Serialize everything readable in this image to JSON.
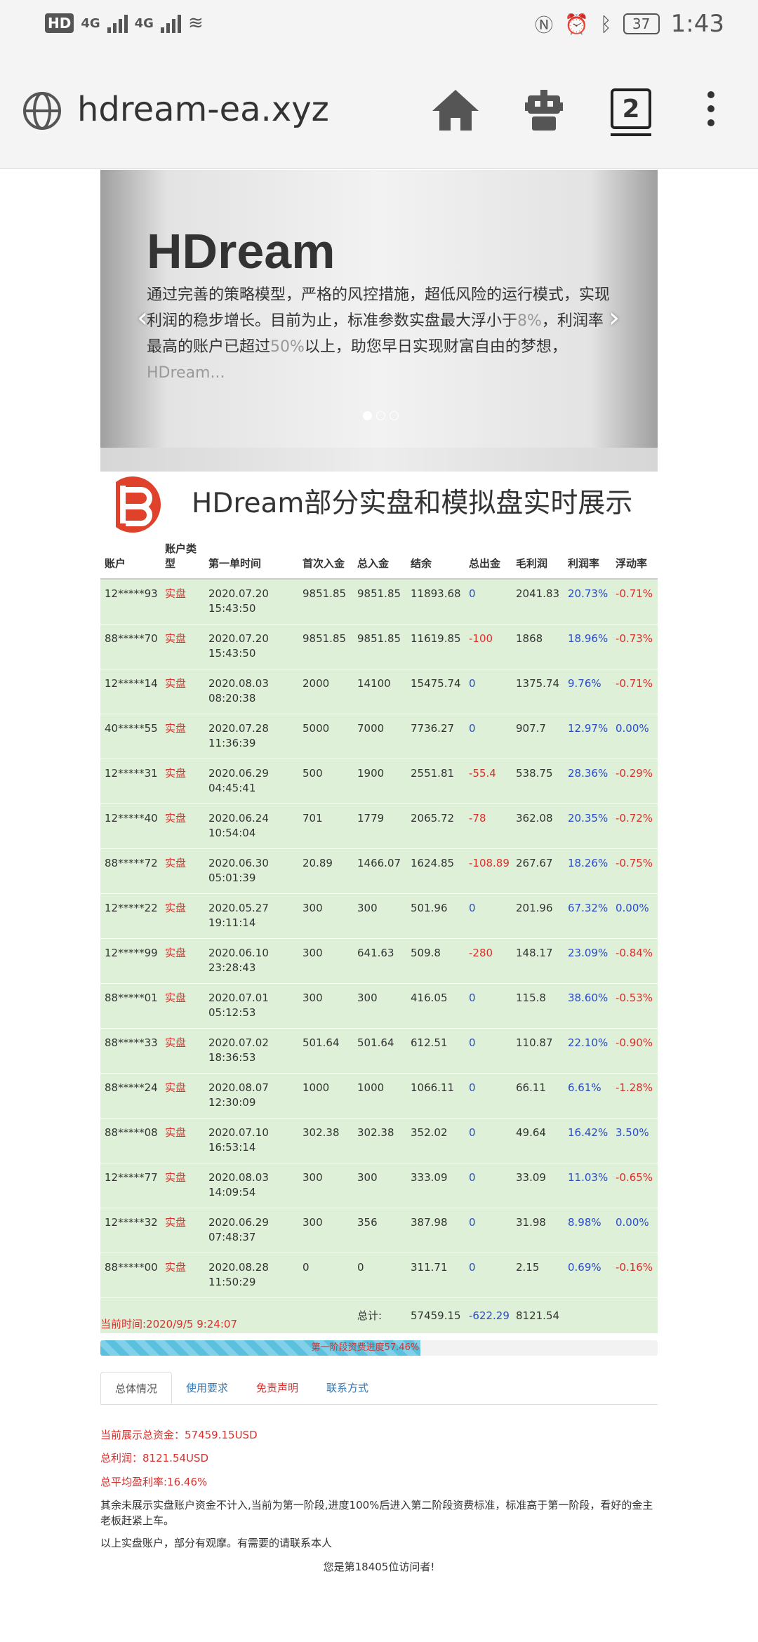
{
  "status_bar": {
    "hd_label": "HD",
    "net_a": "4G",
    "net_b": "4G",
    "battery": "37",
    "time": "1:43"
  },
  "browser": {
    "url": "hdream-ea.xyz",
    "tab_count": "2"
  },
  "carousel": {
    "title": "HDream",
    "text_1": "通过完善的策略模型，严格的风控措施，超低风险的运行模式，实现利润的稳步增长。目前为止，标准参数实盘最大浮小于",
    "text_2": "8%",
    "text_3": "，利润率最高的账户已超过",
    "text_4": "50%",
    "text_5": "以上，助您早日实现财富自由的梦想，",
    "text_6": "HDream...",
    "slide_count": 3,
    "active_slide": 1
  },
  "table": {
    "title": "HDream部分实盘和模拟盘实时展示",
    "headers": [
      "账户",
      "账户类型",
      "第一单时间",
      "首次入金",
      "总入金",
      "结余",
      "总出金",
      "毛利润",
      "利润率",
      "浮动率"
    ],
    "rows": [
      [
        "12*****93",
        "实盘",
        "2020.07.20 15:43:50",
        "9851.85",
        "9851.85",
        "11893.68",
        "0",
        "2041.83",
        "20.73%",
        "-0.71%"
      ],
      [
        "88*****70",
        "实盘",
        "2020.07.20 15:43:50",
        "9851.85",
        "9851.85",
        "11619.85",
        "-100",
        "1868",
        "18.96%",
        "-0.73%"
      ],
      [
        "12*****14",
        "实盘",
        "2020.08.03 08:20:38",
        "2000",
        "14100",
        "15475.74",
        "0",
        "1375.74",
        "9.76%",
        "-0.71%"
      ],
      [
        "40*****55",
        "实盘",
        "2020.07.28 11:36:39",
        "5000",
        "7000",
        "7736.27",
        "0",
        "907.7",
        "12.97%",
        "0.00%"
      ],
      [
        "12*****31",
        "实盘",
        "2020.06.29 04:45:41",
        "500",
        "1900",
        "2551.81",
        "-55.4",
        "538.75",
        "28.36%",
        "-0.29%"
      ],
      [
        "12*****40",
        "实盘",
        "2020.06.24 10:54:04",
        "701",
        "1779",
        "2065.72",
        "-78",
        "362.08",
        "20.35%",
        "-0.72%"
      ],
      [
        "88*****72",
        "实盘",
        "2020.06.30 05:01:39",
        "20.89",
        "1466.07",
        "1624.85",
        "-108.89",
        "267.67",
        "18.26%",
        "-0.75%"
      ],
      [
        "12*****22",
        "实盘",
        "2020.05.27 19:11:14",
        "300",
        "300",
        "501.96",
        "0",
        "201.96",
        "67.32%",
        "0.00%"
      ],
      [
        "12*****99",
        "实盘",
        "2020.06.10 23:28:43",
        "300",
        "641.63",
        "509.8",
        "-280",
        "148.17",
        "23.09%",
        "-0.84%"
      ],
      [
        "88*****01",
        "实盘",
        "2020.07.01 05:12:53",
        "300",
        "300",
        "416.05",
        "0",
        "115.8",
        "38.60%",
        "-0.53%"
      ],
      [
        "88*****33",
        "实盘",
        "2020.07.02 18:36:53",
        "501.64",
        "501.64",
        "612.51",
        "0",
        "110.87",
        "22.10%",
        "-0.90%"
      ],
      [
        "88*****24",
        "实盘",
        "2020.08.07 12:30:09",
        "1000",
        "1000",
        "1066.11",
        "0",
        "66.11",
        "6.61%",
        "-1.28%"
      ],
      [
        "88*****08",
        "实盘",
        "2020.07.10 16:53:14",
        "302.38",
        "302.38",
        "352.02",
        "0",
        "49.64",
        "16.42%",
        "3.50%"
      ],
      [
        "12*****77",
        "实盘",
        "2020.08.03 14:09:54",
        "300",
        "300",
        "333.09",
        "0",
        "33.09",
        "11.03%",
        "-0.65%"
      ],
      [
        "12*****32",
        "实盘",
        "2020.06.29 07:48:37",
        "300",
        "356",
        "387.98",
        "0",
        "31.98",
        "8.98%",
        "0.00%"
      ],
      [
        "88*****00",
        "实盘",
        "2020.08.28 11:50:29",
        "0",
        "0",
        "311.71",
        "0",
        "2.15",
        "0.69%",
        "-0.16%"
      ]
    ],
    "total_label": "总计:",
    "total_balance": "57459.15",
    "total_withdraw": "-622.29",
    "total_profit": "8121.54"
  },
  "current_time": "当前时间:2020/9/5 9:24:07",
  "progress": {
    "label": "第一阶段资费进度57.46%",
    "value": 0.5746
  },
  "tabs": [
    "总体情况",
    "使用要求",
    "免责声明",
    "联系方式"
  ],
  "summary": {
    "total_funds": "当前展示总资金：57459.15USD",
    "total_profit": "总利润：8121.54USD",
    "avg_rate": "总平均盈利率:16.46%",
    "note_1": "其余未展示实盘账户资金不计入,当前为第一阶段,进度100%后进入第二阶段资费标准，标准高于第一阶段，看好的金主老板赶紧上车。",
    "note_2": "以上实盘账户，部分有观摩。有需要的请联系本人",
    "visitor": "您是第18405位访问者!"
  },
  "colors": {
    "row_bg": "#dff0d8",
    "red": "#d9302c",
    "blue": "#2a4cc4",
    "progress": "#5bc0de"
  }
}
